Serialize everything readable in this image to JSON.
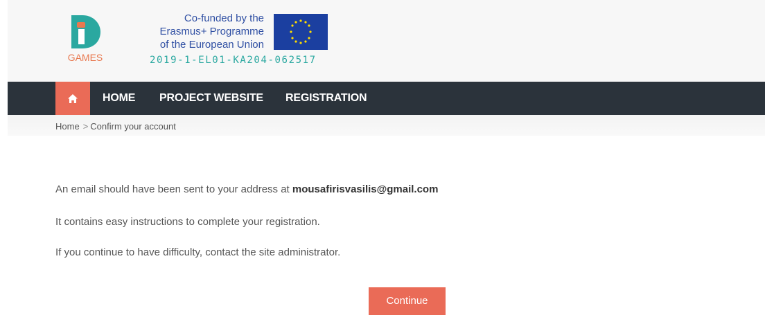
{
  "header": {
    "logo_text": "GAMES",
    "eu_text_lines": [
      "Co-funded by the",
      "Erasmus+ Programme",
      "of the European Union"
    ],
    "project_code": "2019-1-EL01-KA204-062517",
    "colors": {
      "logo_teal": "#2aa8a0",
      "logo_orange": "#e8784f",
      "eu_blue": "#1b3fa0",
      "eu_star": "#ffdd00"
    }
  },
  "nav": {
    "home_icon": "home-icon",
    "items": [
      {
        "label": "HOME"
      },
      {
        "label": "PROJECT WEBSITE"
      },
      {
        "label": "REGISTRATION"
      }
    ],
    "colors": {
      "bar": "#2b333b",
      "active": "#ea6b57"
    }
  },
  "breadcrumb": {
    "home": "Home",
    "separator": ">",
    "current": "Confirm your account"
  },
  "content": {
    "line1_prefix": "An email should have been sent to your address at ",
    "email": "mousafirisvasilis@gmail.com",
    "line2": "It contains easy instructions to complete your registration.",
    "line3": "If you continue to have difficulty, contact the site administrator."
  },
  "continue_button": {
    "label": "Continue",
    "color": "#ea6b57"
  }
}
